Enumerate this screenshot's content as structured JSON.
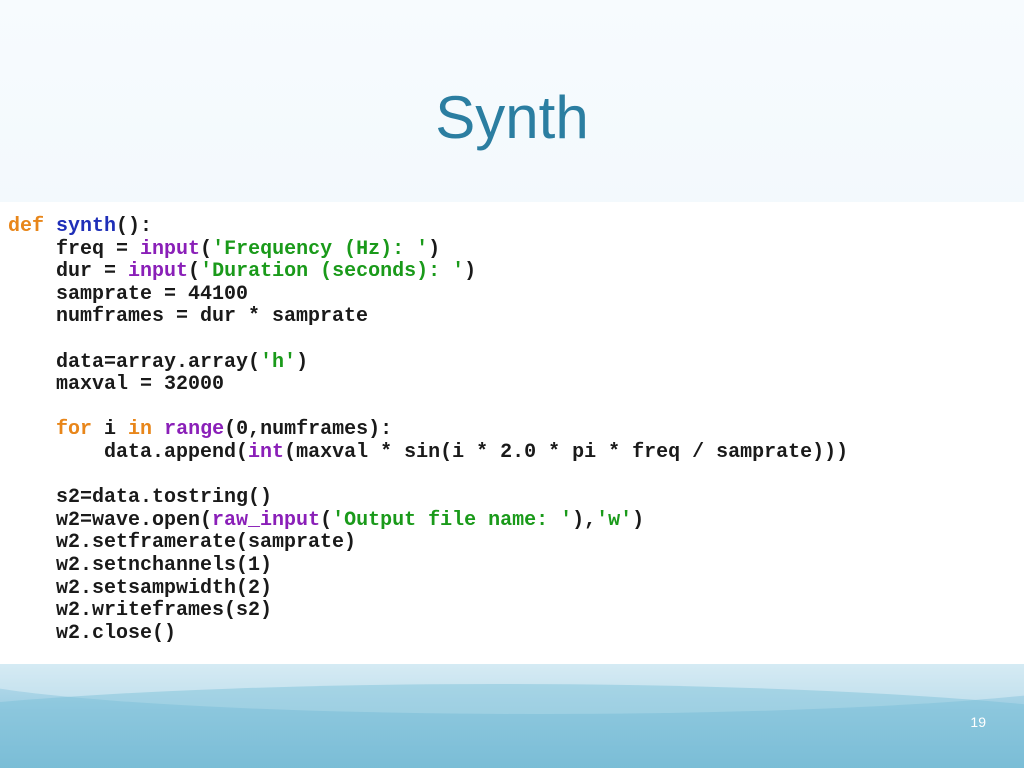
{
  "slide": {
    "title": "Synth",
    "page_number": "19"
  },
  "code": {
    "lines": [
      [
        {
          "t": "def",
          "c": "kw"
        },
        {
          "t": " ",
          "c": ""
        },
        {
          "t": "synth",
          "c": "fn"
        },
        {
          "t": "():",
          "c": ""
        }
      ],
      [
        {
          "t": "    freq = ",
          "c": ""
        },
        {
          "t": "input",
          "c": "bi"
        },
        {
          "t": "(",
          "c": ""
        },
        {
          "t": "'Frequency (Hz): '",
          "c": "str"
        },
        {
          "t": ")",
          "c": ""
        }
      ],
      [
        {
          "t": "    dur = ",
          "c": ""
        },
        {
          "t": "input",
          "c": "bi"
        },
        {
          "t": "(",
          "c": ""
        },
        {
          "t": "'Duration (seconds): '",
          "c": "str"
        },
        {
          "t": ")",
          "c": ""
        }
      ],
      [
        {
          "t": "    samprate = 44100",
          "c": ""
        }
      ],
      [
        {
          "t": "    numframes = dur * samprate",
          "c": ""
        }
      ],
      [
        {
          "t": "",
          "c": ""
        }
      ],
      [
        {
          "t": "    data=array.array(",
          "c": ""
        },
        {
          "t": "'h'",
          "c": "str"
        },
        {
          "t": ")",
          "c": ""
        }
      ],
      [
        {
          "t": "    maxval = 32000",
          "c": ""
        }
      ],
      [
        {
          "t": "",
          "c": ""
        }
      ],
      [
        {
          "t": "    ",
          "c": ""
        },
        {
          "t": "for",
          "c": "kw"
        },
        {
          "t": " i ",
          "c": ""
        },
        {
          "t": "in",
          "c": "kw"
        },
        {
          "t": " ",
          "c": ""
        },
        {
          "t": "range",
          "c": "bi"
        },
        {
          "t": "(0,numframes):",
          "c": ""
        }
      ],
      [
        {
          "t": "        data.append(",
          "c": ""
        },
        {
          "t": "int",
          "c": "bi"
        },
        {
          "t": "(maxval * sin(i * 2.0 * pi * freq / samprate)))",
          "c": ""
        }
      ],
      [
        {
          "t": "",
          "c": ""
        }
      ],
      [
        {
          "t": "    s2=data.tostring()",
          "c": ""
        }
      ],
      [
        {
          "t": "    w2=wave.open(",
          "c": ""
        },
        {
          "t": "raw_input",
          "c": "bi"
        },
        {
          "t": "(",
          "c": ""
        },
        {
          "t": "'Output file name: '",
          "c": "str"
        },
        {
          "t": "),",
          "c": ""
        },
        {
          "t": "'w'",
          "c": "str"
        },
        {
          "t": ")",
          "c": ""
        }
      ],
      [
        {
          "t": "    w2.setframerate(samprate)",
          "c": ""
        }
      ],
      [
        {
          "t": "    w2.setnchannels(1)",
          "c": ""
        }
      ],
      [
        {
          "t": "    w2.setsampwidth(2)",
          "c": ""
        }
      ],
      [
        {
          "t": "    w2.writeframes(s2)",
          "c": ""
        }
      ],
      [
        {
          "t": "    w2.close()",
          "c": ""
        }
      ]
    ]
  },
  "colors": {
    "title": "#2b7ea1",
    "keyword": "#e8861a",
    "function_name": "#1f2fb8",
    "builtin": "#8a1fb8",
    "string": "#1a9a1a"
  }
}
